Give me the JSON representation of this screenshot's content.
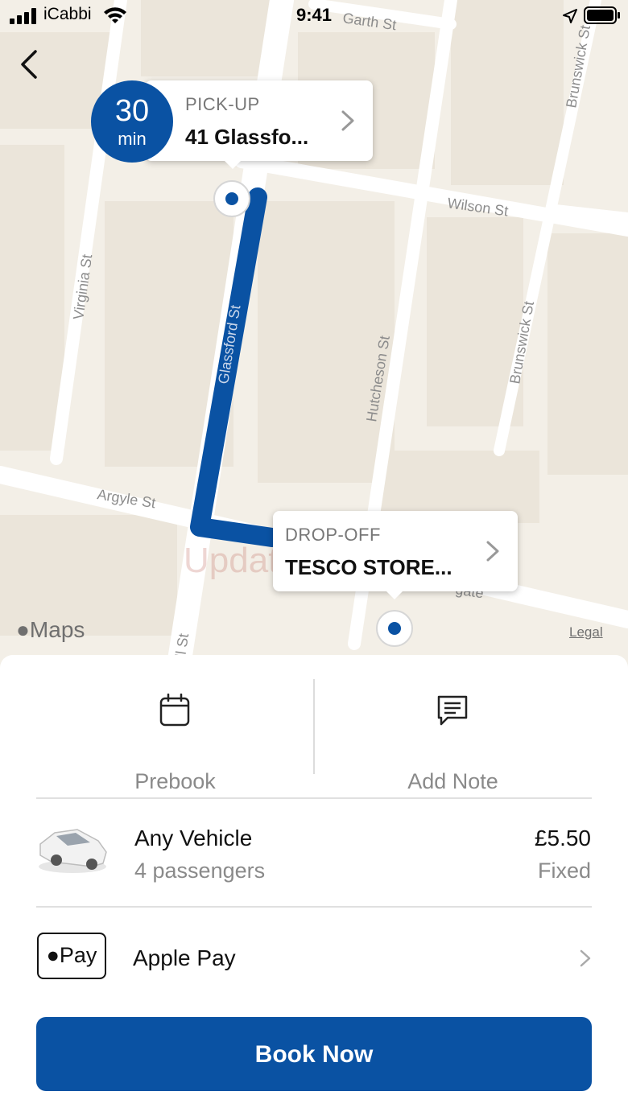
{
  "status_bar": {
    "carrier": "iCabbi",
    "time": "9:41"
  },
  "map": {
    "streets": [
      "Garth St",
      "Wilson St",
      "Brunswick St",
      "Brunswick St",
      "Virginia St",
      "Glassford St",
      "Hutcheson St",
      "Argyle St",
      "ll St",
      "gate"
    ],
    "watermark": "UpdateStar.com",
    "provider": "Maps",
    "legal": "Legal",
    "route_color": "#0a52a3"
  },
  "eta": {
    "value": "30",
    "unit": "min"
  },
  "pickup": {
    "label": "PICK-UP",
    "address": "41 Glassfo..."
  },
  "dropoff": {
    "label": "DROP-OFF",
    "address": "TESCO STORE..."
  },
  "actions": {
    "prebook": {
      "label": "Prebook",
      "icon": "calendar-icon"
    },
    "add_note": {
      "label": "Add Note",
      "icon": "note-icon"
    }
  },
  "vehicle": {
    "name": "Any Vehicle",
    "passengers": "4 passengers",
    "price": "£5.50",
    "price_type": "Fixed",
    "icon": "car-icon"
  },
  "payment": {
    "badge": "Pay",
    "name": "Apple Pay"
  },
  "book_button": {
    "label": "Book Now",
    "color": "#0a52a3"
  }
}
